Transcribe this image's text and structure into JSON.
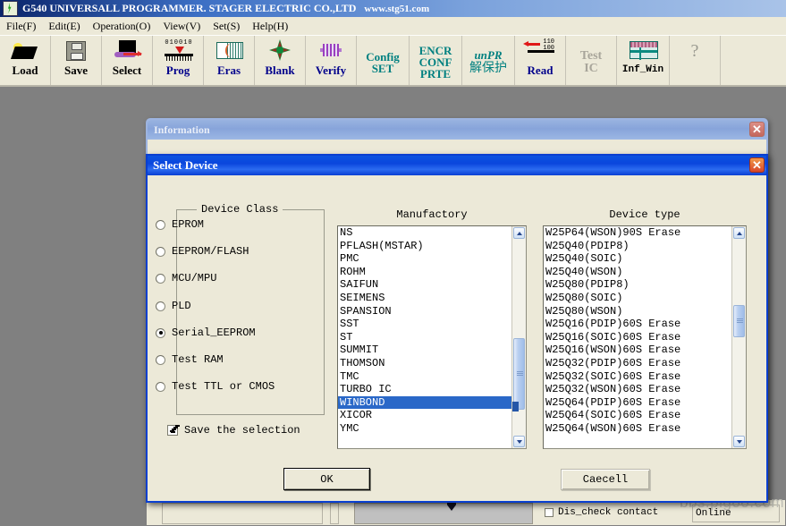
{
  "app": {
    "title": "G540 UNIVERSALL PROGRAMMER. STAGER ELECTRIC CO.,LTD",
    "url": "www.stg51.com",
    "logo_icon": "lightning-logo-icon"
  },
  "menubar": {
    "items": [
      {
        "label": "File(F)"
      },
      {
        "label": "Edit(E)"
      },
      {
        "label": "Operation(O)"
      },
      {
        "label": "View(V)"
      },
      {
        "label": "Set(S)"
      },
      {
        "label": "Help(H)"
      }
    ]
  },
  "toolbar": {
    "buttons": [
      {
        "label": "Load",
        "icon": "open-folder-icon",
        "style": "black"
      },
      {
        "label": "Save",
        "icon": "floppy-disk-icon",
        "style": "black"
      },
      {
        "label": "Select",
        "icon": "chip-select-icon",
        "style": "black"
      },
      {
        "label": "Prog",
        "icon": "program-chip-icon",
        "style": "blue"
      },
      {
        "label": "Eras",
        "icon": "erase-icon",
        "style": "blue"
      },
      {
        "label": "Blank",
        "icon": "blank-check-icon",
        "style": "blue"
      },
      {
        "label": "Verify",
        "icon": "verify-icon",
        "style": "blue"
      },
      {
        "label": "Test IC",
        "icon": "test-ic-icon",
        "style": "gray"
      },
      {
        "label": "Inf_Win",
        "icon": "info-window-icon",
        "style": "mono"
      }
    ],
    "config_set": {
      "line1": "Config",
      "line2": "SET"
    },
    "encr": {
      "line1": "ENCR",
      "line2": "CONF",
      "line3": "PRTE"
    },
    "unpr": {
      "line1": "unPR",
      "line2": "解保护"
    },
    "read_label": "Read",
    "read_bits_top": "110",
    "read_bits_bottom": "100",
    "prog_bits": "010010",
    "help_icon": "question-mark-icon"
  },
  "info_dialog": {
    "title": "Information",
    "close_icon": "close-icon"
  },
  "select_dialog": {
    "title": "Select Device",
    "close_icon": "close-icon",
    "device_class": {
      "legend": "Device Class",
      "options": [
        {
          "label": "EPROM",
          "selected": false
        },
        {
          "label": "EEPROM/FLASH",
          "selected": false
        },
        {
          "label": "MCU/MPU",
          "selected": false
        },
        {
          "label": "PLD",
          "selected": false
        },
        {
          "label": "Serial_EEPROM",
          "selected": true
        },
        {
          "label": "Test RAM",
          "selected": false
        },
        {
          "label": "Test TTL or CMOS",
          "selected": false
        }
      ]
    },
    "save_selection": {
      "label": "Save the selection",
      "checked": true
    },
    "manufactory": {
      "header": "Manufactory",
      "items": [
        "NS",
        "PFLASH(MSTAR)",
        "PMC",
        "ROHM",
        "SAIFUN",
        "SEIMENS",
        "SPANSION",
        "SST",
        "ST",
        "SUMMIT",
        "THOMSON",
        "TMC",
        "TURBO IC",
        "WINBOND",
        "XICOR",
        "YMC"
      ],
      "selected": "WINBOND",
      "scroll_up_icon": "chevron-up-icon",
      "scroll_down_icon": "chevron-down-icon"
    },
    "device_type": {
      "header": "Device type",
      "items": [
        "W25P64(WSON)90S Erase",
        "W25Q40(PDIP8)",
        "W25Q40(SOIC)",
        "W25Q40(WSON)",
        "W25Q80(PDIP8)",
        "W25Q80(SOIC)",
        "W25Q80(WSON)",
        "W25Q16(PDIP)60S Erase",
        "W25Q16(SOIC)60S Erase",
        "W25Q16(WSON)60S Erase",
        "W25Q32(PDIP)60S Erase",
        "W25Q32(SOIC)60S Erase",
        "W25Q32(WSON)60S Erase",
        "W25Q64(PDIP)60S Erase",
        "W25Q64(SOIC)60S Erase",
        "W25Q64(WSON)60S Erase"
      ],
      "selected": null,
      "scroll_up_icon": "chevron-up-icon",
      "scroll_down_icon": "chevron-down-icon"
    },
    "ok_button": "OK",
    "cancel_button": "Caecell"
  },
  "main_window_bottom": {
    "dis_check_contact": {
      "label": "Dis_check contact",
      "checked": false
    },
    "status": "Online",
    "watermark": "bbs.pigoo.com"
  }
}
